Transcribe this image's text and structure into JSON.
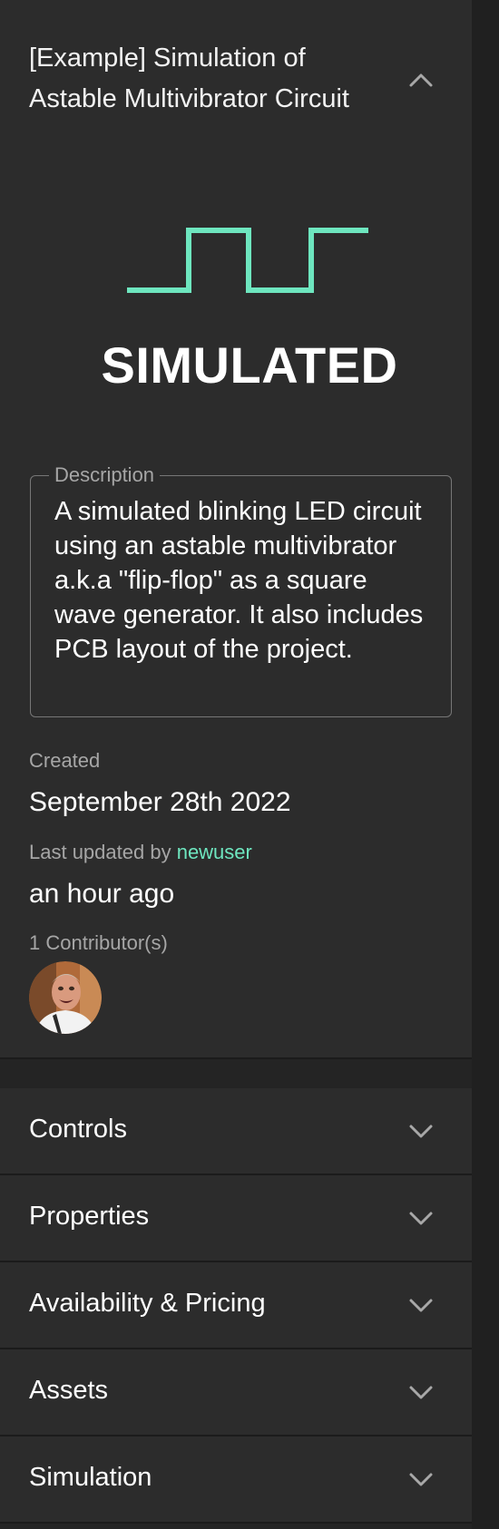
{
  "project": {
    "title": "[Example] Simulation of Astable Multivibrator Circuit",
    "status": "SIMULATED",
    "status_color": "#6ee6bf"
  },
  "description": {
    "label": "Description",
    "text": "A simulated blinking LED circuit using an astable multivibrator a.k.a \"flip-flop\" as a square wave generator. It also includes PCB layout of the project."
  },
  "meta": {
    "created_label": "Created",
    "created_value": "September 28th 2022",
    "updated_label": "Last updated by",
    "updated_user": "newuser",
    "updated_value": "an hour ago",
    "contributors_label": "1 Contributor(s)"
  },
  "icons": {
    "collapse": "chevron-up-icon",
    "expand": "chevron-down-icon",
    "status": "square-wave-icon"
  },
  "sections": [
    {
      "label": "Controls"
    },
    {
      "label": "Properties"
    },
    {
      "label": "Availability & Pricing"
    },
    {
      "label": "Assets"
    },
    {
      "label": "Simulation"
    }
  ]
}
